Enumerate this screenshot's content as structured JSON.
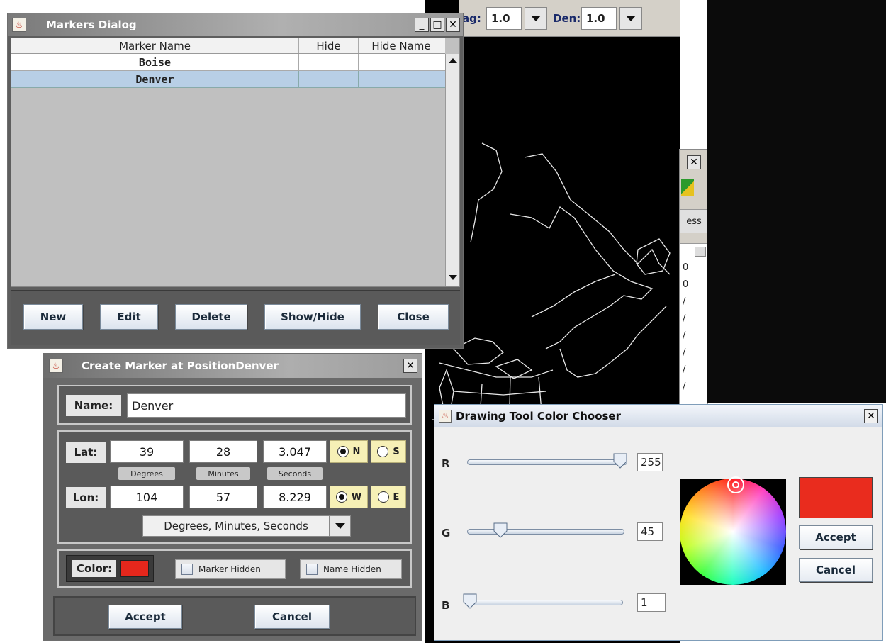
{
  "background_app": {
    "mag_label": "ag:",
    "mag_value": "1.0",
    "den_label": "Den:",
    "den_value": "1.0",
    "partial_button": "ess",
    "list_fragments": [
      "0",
      "0",
      "/",
      "/",
      "/",
      "/",
      "/",
      "/",
      "/",
      "/"
    ]
  },
  "markers_dialog": {
    "title": "Markers Dialog",
    "columns": [
      "Marker Name",
      "Hide",
      "Hide Name"
    ],
    "rows": [
      {
        "name": "Boise",
        "hide": "",
        "hide_name": ""
      },
      {
        "name": "Denver",
        "hide": "",
        "hide_name": ""
      }
    ],
    "buttons": {
      "new": "New",
      "edit": "Edit",
      "delete": "Delete",
      "show_hide": "Show/Hide",
      "close": "Close"
    }
  },
  "create_marker": {
    "title": "Create Marker at PositionDenver",
    "name_label": "Name:",
    "name_value": "Denver",
    "lat_label": "Lat:",
    "lat": {
      "degrees": "39",
      "minutes": "28",
      "seconds": "3.047"
    },
    "lon_label": "Lon:",
    "lon": {
      "degrees": "104",
      "minutes": "57",
      "seconds": "8.229"
    },
    "unit_labels": {
      "degrees": "Degrees",
      "minutes": "Minutes",
      "seconds": "Seconds"
    },
    "hemisphere": {
      "n": "N",
      "s": "S",
      "w": "W",
      "e": "E",
      "lat_selected": "N",
      "lon_selected": "W"
    },
    "format_select": "Degrees, Minutes, Seconds",
    "color_label": "Color:",
    "color_value": "#e5271c",
    "marker_hidden_label": "Marker Hidden",
    "name_hidden_label": "Name Hidden",
    "accept": "Accept",
    "cancel": "Cancel"
  },
  "color_chooser": {
    "title": "Drawing Tool Color Chooser",
    "r_label": "R",
    "r_value": "255",
    "r_level": 1.0,
    "g_label": "G",
    "g_value": "45",
    "g_level": 0.18,
    "b_label": "B",
    "b_value": "1",
    "b_level": 0.0,
    "preview_color": "#e92c1e",
    "accept": "Accept",
    "cancel": "Cancel"
  },
  "colors": {
    "dialog_gray": "#666666",
    "title_gradient_start": "#8a8a8a",
    "selected_row": "#b8cfe6",
    "hemisphere_bg": "#f6f0b6"
  }
}
